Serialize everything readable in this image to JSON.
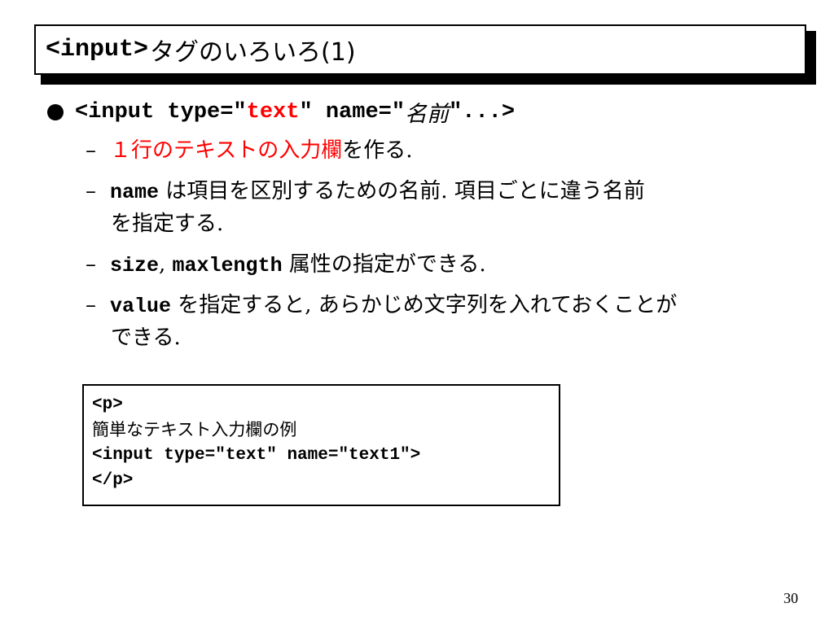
{
  "title": {
    "tag": "<input>",
    "rest": "タグのいろいろ(1)"
  },
  "bullet": {
    "part1": "<input type=\"",
    "type_value": "text",
    "part2": "\" name=\"",
    "name_value": "名前",
    "part3": "\"...>"
  },
  "items": [
    {
      "text": "１行のテキストの入力欄",
      "suffix": "を作る."
    },
    {
      "code": "name",
      "text": " は項目を区別するための名前. 項目ごとに違う名前",
      "cont": "を指定する."
    },
    {
      "code": "size",
      "sep": ", ",
      "code2": "maxlength",
      "text": " 属性の指定ができる."
    },
    {
      "code": "value",
      "text": " を指定すると, あらかじめ文字列を入れておくことが",
      "cont": "できる."
    }
  ],
  "dash": "–",
  "code_example": {
    "line1": "<p>",
    "line2": "簡単なテキスト入力欄の例",
    "line3": "<input type=\"text\" name=\"text1\">",
    "line4": "</p>"
  },
  "page_number": "30"
}
